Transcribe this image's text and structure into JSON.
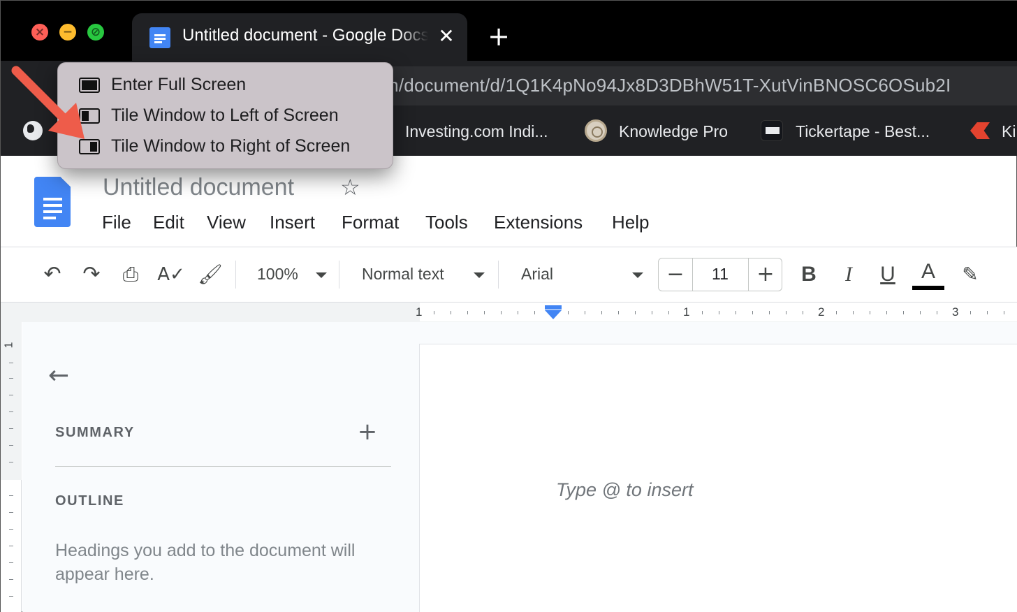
{
  "window_controls": {
    "close_symbol": "×",
    "minimize_symbol": "−",
    "fullscreen_symbol": "⊘"
  },
  "tab": {
    "title": "Untitled document - Google Docs",
    "close_symbol": "✕",
    "new_tab_symbol": "+"
  },
  "address_bar": {
    "url_visible": "m/document/d/1Q1K4pNo94Jx8D3DBhW51T-XutVinBNOSC6OSub2I"
  },
  "bookmarks": [
    {
      "label": "Investing.com Indi...",
      "icon": "investing-icon"
    },
    {
      "label": "Knowledge Pro",
      "icon": "knowledge-pro-icon"
    },
    {
      "label": "Tickertape - Best...",
      "icon": "tickertape-icon"
    },
    {
      "label": "Ki",
      "icon": "ki-icon"
    }
  ],
  "window_menu": {
    "items": [
      {
        "label": "Enter Full Screen",
        "icon": "full-screen-icon"
      },
      {
        "label": "Tile Window to Left of Screen",
        "icon": "tile-left-icon"
      },
      {
        "label": "Tile Window to Right of Screen",
        "icon": "tile-right-icon"
      }
    ]
  },
  "docs": {
    "title": "Untitled document",
    "menu": [
      "File",
      "Edit",
      "View",
      "Insert",
      "Format",
      "Tools",
      "Extensions",
      "Help"
    ],
    "toolbar": {
      "zoom": "100%",
      "style": "Normal text",
      "font": "Arial",
      "font_size": "11",
      "minus": "−",
      "plus": "+"
    },
    "ruler": {
      "labels": [
        "1",
        "1",
        "2",
        "3"
      ],
      "vertical_label": "1"
    },
    "outline": {
      "summary_heading": "SUMMARY",
      "summary_add": "+",
      "outline_heading": "OUTLINE",
      "help_text": "Headings you add to the document will appear here."
    },
    "body_hint": "Type @ to insert"
  },
  "colors": {
    "annotation_arrow": "#ee5c4a",
    "docs_blue": "#4285f4",
    "popover_bg": "#cbc4c9"
  }
}
